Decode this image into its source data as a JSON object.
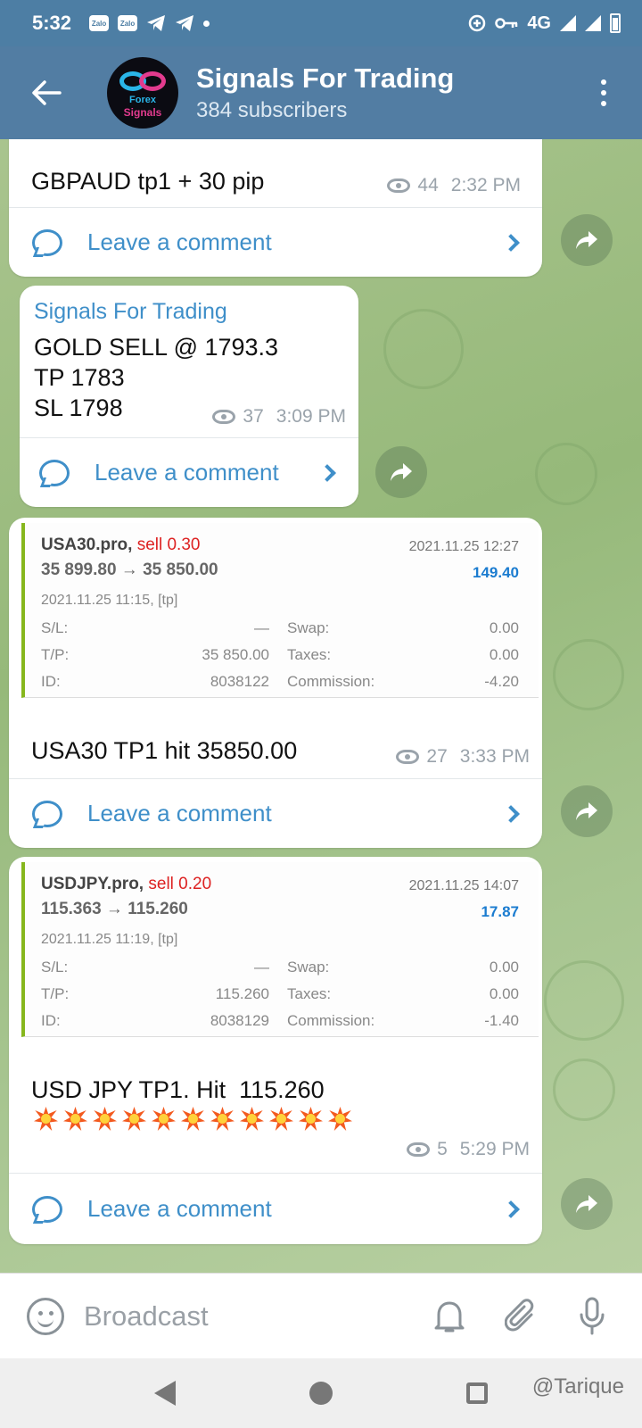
{
  "status_bar": {
    "time": "5:32",
    "notif_icons": [
      "Zalo",
      "Zalo"
    ],
    "network": "4G"
  },
  "header": {
    "channel_name": "Signals For Trading",
    "subscribers": "384 subscribers",
    "avatar_line1": "Forex",
    "avatar_line2": "Signals"
  },
  "messages": [
    {
      "text": "GBPAUD tp1 + 30 pip",
      "views": "44",
      "time": "2:32 PM",
      "comment_label": "Leave a comment"
    },
    {
      "sender": "Signals For Trading",
      "lines": [
        "GOLD SELL @ 1793.3",
        "TP 1783",
        "SL 1798"
      ],
      "views": "37",
      "time": "3:09 PM",
      "comment_label": "Leave a comment"
    },
    {
      "trade": {
        "symbol": "USA30.pro,",
        "side": "sell 0.30",
        "close_date": "2021.11.25 12:27",
        "prices": "35 899.80 → 35 850.00",
        "profit": "149.40",
        "open_info": "2021.11.25 11:15, [tp]",
        "rows": [
          {
            "label1": "S/L:",
            "value1": "—",
            "label2": "Swap:",
            "value2": "0.00"
          },
          {
            "label1": "T/P:",
            "value1": "35 850.00",
            "label2": "Taxes:",
            "value2": "0.00"
          },
          {
            "label1": "ID:",
            "value1": "8038122",
            "label2": "Commission:",
            "value2": "-4.20"
          }
        ]
      },
      "text": "USA30 TP1 hit 35850.00",
      "views": "27",
      "time": "3:33 PM",
      "comment_label": "Leave a comment"
    },
    {
      "trade": {
        "symbol": "USDJPY.pro,",
        "side": "sell 0.20",
        "close_date": "2021.11.25 14:07",
        "prices": "115.363 → 115.260",
        "profit": "17.87",
        "open_info": "2021.11.25 11:19, [tp]",
        "rows": [
          {
            "label1": "S/L:",
            "value1": "—",
            "label2": "Swap:",
            "value2": "0.00"
          },
          {
            "label1": "T/P:",
            "value1": "115.260",
            "label2": "Taxes:",
            "value2": "0.00"
          },
          {
            "label1": "ID:",
            "value1": "8038129",
            "label2": "Commission:",
            "value2": "-1.40"
          }
        ]
      },
      "text": "USD JPY TP1. Hit  115.260",
      "explosion_count": 11,
      "views": "5",
      "time": "5:29 PM",
      "comment_label": "Leave a comment"
    }
  ],
  "input_bar": {
    "placeholder": "Broadcast"
  },
  "watermark": "@Tarique",
  "colors": {
    "header": "#527da3",
    "accent": "#3f8fc9",
    "sell": "#dd2222",
    "profit": "#1b7cd0",
    "trade_border": "#86b71d"
  }
}
